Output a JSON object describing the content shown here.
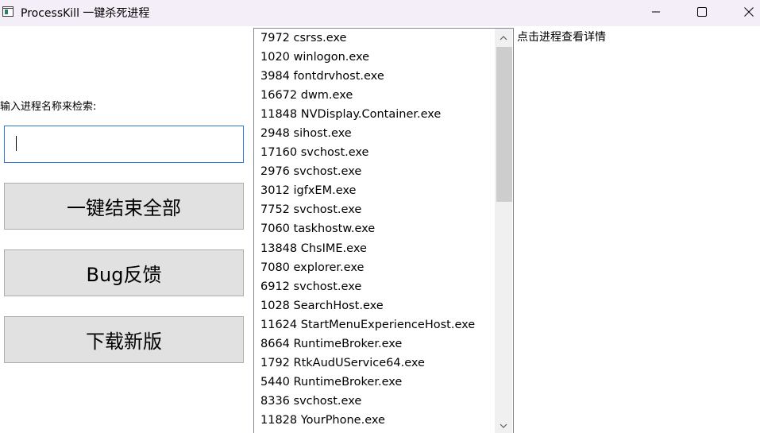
{
  "window": {
    "title": "ProcessKill 一键杀死进程"
  },
  "search": {
    "label": "输入进程名称来检索:",
    "value": "",
    "placeholder": ""
  },
  "buttons": {
    "kill_all": "一键结束全部",
    "bug_report": "Bug反馈",
    "download_new": "下载新版"
  },
  "process_list": [
    "7972 csrss.exe",
    "1020 winlogon.exe",
    "3984 fontdrvhost.exe",
    "16672 dwm.exe",
    "11848 NVDisplay.Container.exe",
    "2948 sihost.exe",
    "17160 svchost.exe",
    "2976 svchost.exe",
    "3012 igfxEM.exe",
    "7752 svchost.exe",
    "7060 taskhostw.exe",
    "13848 ChsIME.exe",
    "7080 explorer.exe",
    "6912 svchost.exe",
    "1028 SearchHost.exe",
    "11624 StartMenuExperienceHost.exe",
    "8664 RuntimeBroker.exe",
    "1792 RtkAudUService64.exe",
    "5440 RuntimeBroker.exe",
    "8336 svchost.exe",
    "11828 YourPhone.exe"
  ],
  "details": {
    "hint": "点击进程查看详情"
  },
  "icons": {
    "app": "app-window-icon",
    "minimize": "minimize-icon",
    "maximize": "maximize-icon",
    "close": "close-icon",
    "scroll_up": "chevron-up-icon",
    "scroll_down": "chevron-down-icon"
  }
}
